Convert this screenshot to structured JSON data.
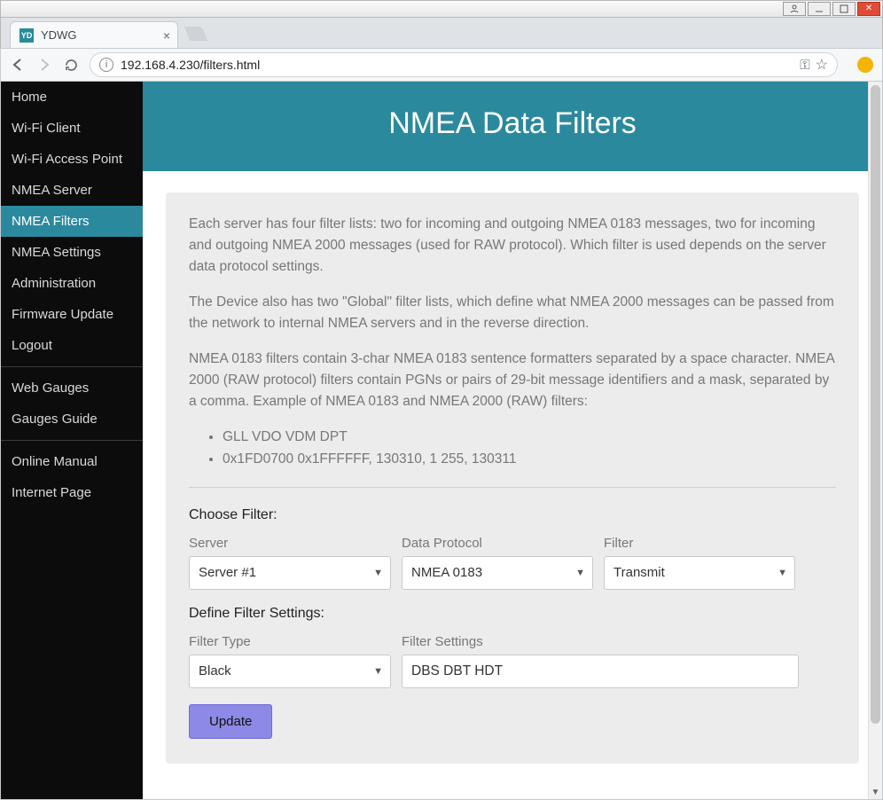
{
  "window": {
    "title": "YDWG",
    "favicon_text": "YD"
  },
  "addressbar": {
    "url": "192.168.4.230/filters.html"
  },
  "sidebar": {
    "groups": [
      [
        "Home",
        "Wi-Fi Client",
        "Wi-Fi Access Point",
        "NMEA Server",
        "NMEA Filters",
        "NMEA Settings",
        "Administration",
        "Firmware Update",
        "Logout"
      ],
      [
        "Web Gauges",
        "Gauges Guide"
      ],
      [
        "Online Manual",
        "Internet Page"
      ]
    ],
    "active": "NMEA Filters"
  },
  "hero": {
    "title": "NMEA Data Filters"
  },
  "intro": {
    "p1": "Each server has four filter lists: two for incoming and outgoing NMEA 0183 messages, two for incoming and outgoing NMEA 2000 messages (used for RAW protocol). Which filter is used depends on the server data protocol settings.",
    "p2": "The Device also has two \"Global\" filter lists, which define what NMEA 2000 messages can be passed from the network to internal NMEA servers and in the reverse direction.",
    "p3": "NMEA 0183 filters contain 3-char NMEA 0183 sentence formatters separated by a space character. NMEA 2000 (RAW protocol) filters contain PGNs or pairs of 29-bit message identifiers and a mask, separated by a comma. Example of NMEA 0183 and NMEA 2000 (RAW) filters:",
    "ex1": "GLL VDO VDM DPT",
    "ex2": "0x1FD0700 0x1FFFFFF, 130310, 1 255, 130311"
  },
  "form": {
    "choose_label": "Choose Filter:",
    "server_label": "Server",
    "server_value": "Server #1",
    "protocol_label": "Data Protocol",
    "protocol_value": "NMEA 0183",
    "filter_label": "Filter",
    "filter_value": "Transmit",
    "define_label": "Define Filter Settings:",
    "filtertype_label": "Filter Type",
    "filtertype_value": "Black",
    "filtersettings_label": "Filter Settings",
    "filtersettings_value": "DBS DBT HDT",
    "update_label": "Update"
  }
}
